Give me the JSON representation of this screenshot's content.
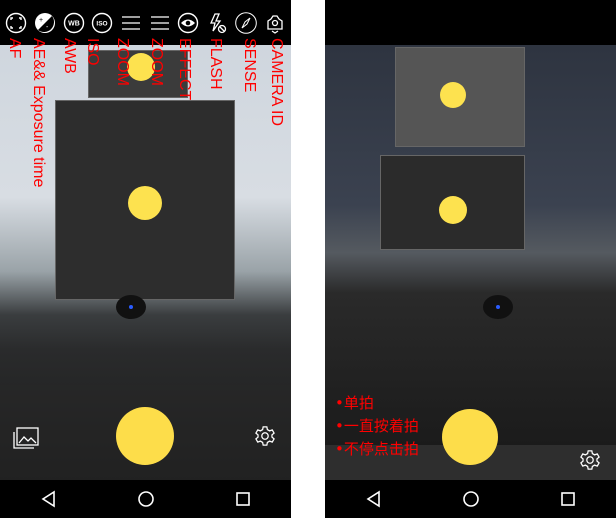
{
  "left_phone": {
    "toolbar": [
      {
        "icon": "af-focus-icon",
        "label": "AF"
      },
      {
        "icon": "exposure-icon",
        "label": "AE&& Exposure time"
      },
      {
        "icon": "white-balance-icon",
        "label": "AWB",
        "glyph": "WB"
      },
      {
        "icon": "iso-icon",
        "label": "ISO",
        "glyph": "ISO"
      },
      {
        "icon": "menu-lines-icon",
        "label": "ZOOM"
      },
      {
        "icon": "menu-lines-icon",
        "label": "ZOOM"
      },
      {
        "icon": "eye-icon",
        "label": "EFFECT"
      },
      {
        "icon": "flash-off-icon",
        "label": "FLASH"
      },
      {
        "icon": "compass-icon",
        "label": "SENSE"
      },
      {
        "icon": "camera-switch-icon",
        "label": "CAMERA ID"
      }
    ]
  },
  "right_phone": {
    "shooting_modes": [
      "•单拍",
      "•一直按着拍",
      "•不停点击拍"
    ]
  },
  "colors": {
    "shutter": "#fddd4a",
    "annotation": "#ff0000"
  }
}
